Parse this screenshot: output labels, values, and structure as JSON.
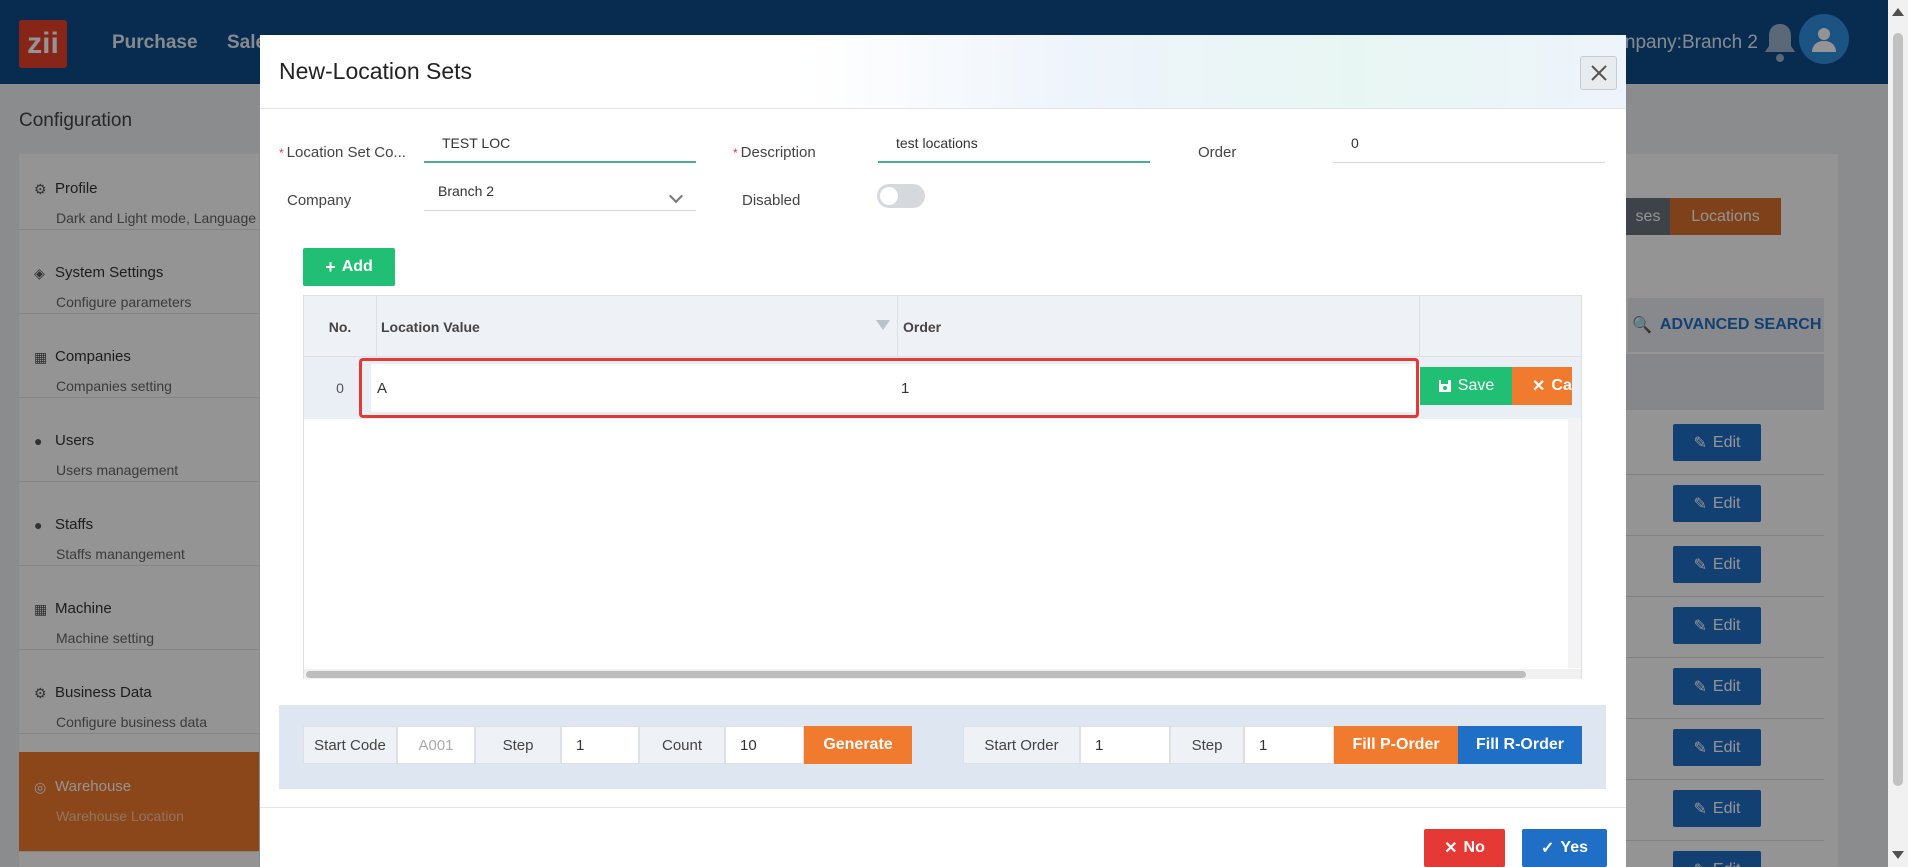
{
  "app": {
    "logo_text": "zii",
    "nav": [
      "Purchase",
      "Sale"
    ],
    "company_text": "npany:Branch 2",
    "page_title": "Configuration"
  },
  "sidebar": {
    "items": [
      {
        "label": "Profile",
        "sub": "Dark and Light mode, Language",
        "icon": "gear-icon"
      },
      {
        "label": "System Settings",
        "sub": "Configure parameters",
        "icon": "tags-icon"
      },
      {
        "label": "Companies",
        "sub": "Companies setting",
        "icon": "building-icon"
      },
      {
        "label": "Users",
        "sub": "Users management",
        "icon": "user-gear-icon"
      },
      {
        "label": "Staffs",
        "sub": "Staffs manangement",
        "icon": "user-gear-icon"
      },
      {
        "label": "Machine",
        "sub": "Machine setting",
        "icon": "building-icon"
      },
      {
        "label": "Business Data",
        "sub": "Configure business data",
        "icon": "gear-icon"
      },
      {
        "label": "Warehouse",
        "sub": "Warehouse Location",
        "icon": "warehouse-icon"
      }
    ]
  },
  "background": {
    "tab_partial": "ses",
    "tab_active": "Locations",
    "advanced_search": "ADVANCED SEARCH",
    "edit_label": "Edit"
  },
  "modal": {
    "title": "New-Location Sets",
    "fields": {
      "location_set_code_label": "Location Set Co...",
      "location_set_code_value": "TEST LOC",
      "description_label": "Description",
      "description_value": "test locations",
      "order_label": "Order",
      "order_value": "0",
      "company_label": "Company",
      "company_value": "Branch 2",
      "disabled_label": "Disabled",
      "disabled_on": false
    },
    "add_label": "Add",
    "grid": {
      "columns": [
        "No.",
        "Location Value",
        "Order"
      ],
      "rows": [
        {
          "no": "0",
          "location_value": "A",
          "order": "1"
        }
      ],
      "save_label": "Save",
      "cancel_label": "Ca"
    },
    "generator": {
      "start_code_label": "Start Code",
      "start_code_placeholder": "A001",
      "step_label": "Step",
      "step_value": "1",
      "count_label": "Count",
      "count_value": "10",
      "generate_label": "Generate",
      "start_order_label": "Start Order",
      "start_order_value": "1",
      "step2_label": "Step",
      "step2_value": "1",
      "fill_p_label": "Fill P-Order",
      "fill_r_label": "Fill R-Order"
    },
    "no_label": "No",
    "yes_label": "Yes"
  },
  "colors": {
    "topbar": "#0f4c8a",
    "accent_green": "#21bf73",
    "accent_orange": "#f07a2e",
    "accent_blue": "#1f6fc7",
    "danger_red": "#e53935"
  }
}
